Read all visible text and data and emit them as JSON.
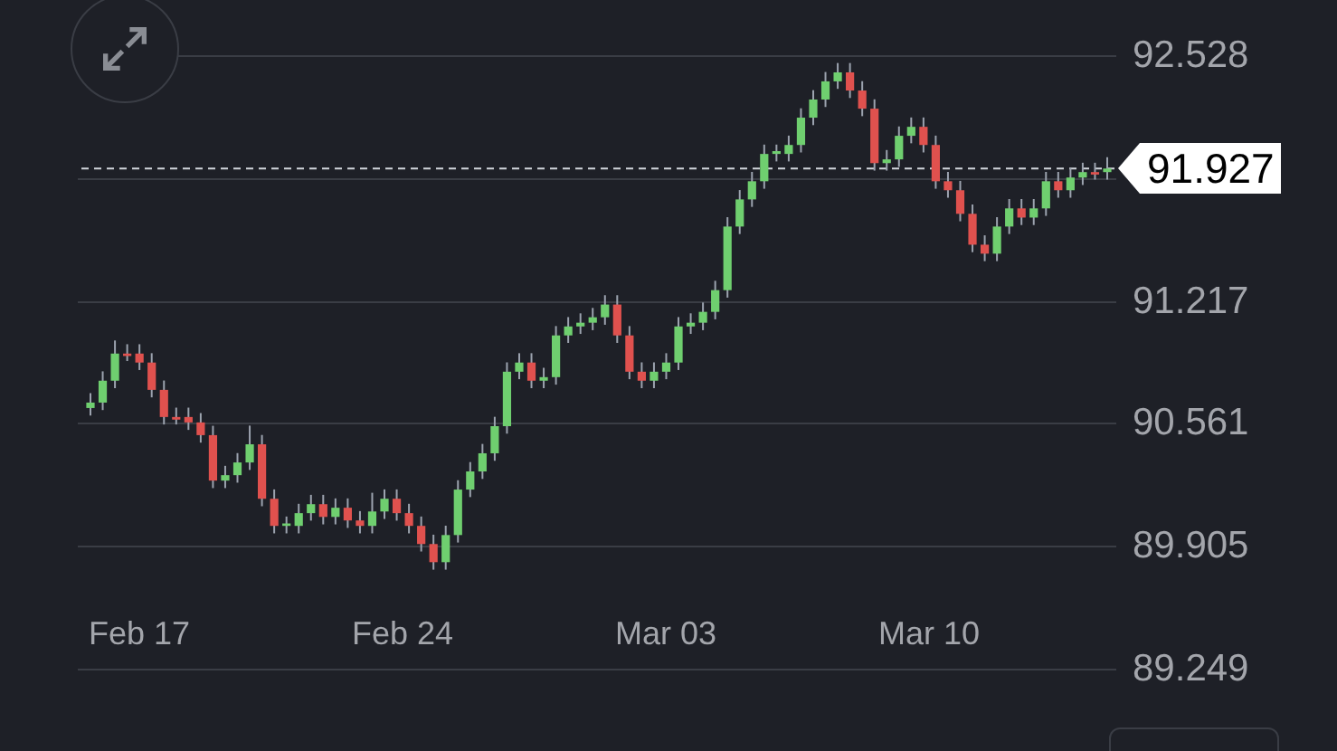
{
  "date_axis": {
    "labels": [
      "Feb 17",
      "Feb 24",
      "Mar 03",
      "Mar 10"
    ]
  },
  "chart_data": {
    "type": "candlestick",
    "ylim": [
      89.249,
      92.528
    ],
    "grid": true,
    "ref_lines": [
      {
        "axis": "y",
        "value": 91.927,
        "label": "91.927"
      }
    ],
    "yticks": [
      {
        "value": 92.528,
        "label": "92.528"
      },
      {
        "value": 91.217,
        "label": "91.217"
      },
      {
        "value": 90.561,
        "label": "90.561"
      },
      {
        "value": 89.905,
        "label": "89.905"
      },
      {
        "value": 89.249,
        "label": "89.249"
      }
    ],
    "ohlc": [
      [
        90.647,
        90.726,
        90.607,
        90.676
      ],
      [
        90.676,
        90.843,
        90.636,
        90.793
      ],
      [
        90.793,
        91.008,
        90.753,
        90.938
      ],
      [
        90.938,
        90.988,
        90.898,
        90.925
      ],
      [
        90.938,
        90.988,
        90.85,
        90.89
      ],
      [
        90.89,
        90.94,
        90.704,
        90.744
      ],
      [
        90.744,
        90.794,
        90.559,
        90.599
      ],
      [
        90.599,
        90.649,
        90.559,
        90.585
      ],
      [
        90.599,
        90.649,
        90.53,
        90.57
      ],
      [
        90.57,
        90.62,
        90.462,
        90.502
      ],
      [
        90.502,
        90.552,
        90.219,
        90.259
      ],
      [
        90.259,
        90.338,
        90.219,
        90.288
      ],
      [
        90.288,
        90.406,
        90.248,
        90.356
      ],
      [
        90.356,
        90.553,
        90.316,
        90.453
      ],
      [
        90.453,
        90.503,
        90.122,
        90.162
      ],
      [
        90.162,
        90.212,
        89.977,
        90.017
      ],
      [
        90.017,
        90.067,
        89.977,
        90.03
      ],
      [
        90.017,
        90.135,
        89.977,
        90.085
      ],
      [
        90.085,
        90.183,
        90.045,
        90.133
      ],
      [
        90.133,
        90.183,
        90.025,
        90.065
      ],
      [
        90.065,
        90.164,
        90.025,
        90.114
      ],
      [
        90.114,
        90.164,
        90.006,
        90.046
      ],
      [
        90.046,
        90.096,
        89.977,
        90.017
      ],
      [
        90.017,
        90.194,
        89.977,
        90.094
      ],
      [
        90.094,
        90.212,
        90.054,
        90.162
      ],
      [
        90.162,
        90.212,
        90.045,
        90.085
      ],
      [
        90.085,
        90.135,
        89.977,
        90.017
      ],
      [
        90.017,
        90.067,
        89.88,
        89.92
      ],
      [
        89.92,
        89.97,
        89.783,
        89.823
      ],
      [
        89.823,
        90.018,
        89.783,
        89.968
      ],
      [
        89.968,
        90.261,
        89.928,
        90.211
      ],
      [
        90.211,
        90.358,
        90.171,
        90.308
      ],
      [
        90.308,
        90.455,
        90.268,
        90.405
      ],
      [
        90.405,
        90.6,
        90.365,
        90.55
      ],
      [
        90.55,
        90.891,
        90.51,
        90.841
      ],
      [
        90.841,
        90.94,
        90.801,
        90.89
      ],
      [
        90.89,
        90.94,
        90.753,
        90.793
      ],
      [
        90.793,
        90.862,
        90.753,
        90.812
      ],
      [
        90.812,
        91.085,
        90.772,
        91.035
      ],
      [
        91.035,
        91.133,
        90.995,
        91.083
      ],
      [
        91.083,
        91.153,
        91.043,
        91.103
      ],
      [
        91.103,
        91.182,
        91.063,
        91.132
      ],
      [
        91.132,
        91.25,
        91.092,
        91.2
      ],
      [
        91.2,
        91.25,
        90.995,
        91.035
      ],
      [
        91.035,
        91.085,
        90.801,
        90.841
      ],
      [
        90.841,
        90.891,
        90.753,
        90.793
      ],
      [
        90.793,
        90.891,
        90.753,
        90.841
      ],
      [
        90.841,
        90.94,
        90.801,
        90.89
      ],
      [
        90.89,
        91.133,
        90.85,
        91.083
      ],
      [
        91.083,
        91.153,
        91.043,
        91.103
      ],
      [
        91.103,
        91.211,
        91.063,
        91.161
      ],
      [
        91.161,
        91.327,
        91.121,
        91.277
      ],
      [
        91.277,
        91.667,
        91.237,
        91.617
      ],
      [
        91.617,
        91.812,
        91.577,
        91.762
      ],
      [
        91.762,
        91.909,
        91.722,
        91.859
      ],
      [
        91.859,
        92.055,
        91.819,
        92.005
      ],
      [
        92.005,
        92.055,
        91.965,
        92.02
      ],
      [
        92.005,
        92.103,
        91.965,
        92.053
      ],
      [
        92.053,
        92.249,
        92.013,
        92.199
      ],
      [
        92.199,
        92.346,
        92.159,
        92.296
      ],
      [
        92.296,
        92.443,
        92.256,
        92.393
      ],
      [
        92.393,
        92.491,
        92.353,
        92.441
      ],
      [
        92.441,
        92.491,
        92.304,
        92.344
      ],
      [
        92.344,
        92.394,
        92.207,
        92.247
      ],
      [
        92.247,
        92.297,
        91.916,
        91.956
      ],
      [
        91.956,
        92.026,
        91.916,
        91.976
      ],
      [
        91.976,
        92.152,
        91.936,
        92.102
      ],
      [
        92.102,
        92.2,
        92.062,
        92.15
      ],
      [
        92.15,
        92.2,
        92.013,
        92.053
      ],
      [
        92.053,
        92.103,
        91.819,
        91.859
      ],
      [
        91.859,
        91.909,
        91.771,
        91.811
      ],
      [
        91.811,
        91.861,
        91.645,
        91.685
      ],
      [
        91.685,
        91.735,
        91.48,
        91.52
      ],
      [
        91.52,
        91.57,
        91.432,
        91.472
      ],
      [
        91.472,
        91.667,
        91.432,
        91.617
      ],
      [
        91.617,
        91.764,
        91.577,
        91.714
      ],
      [
        91.714,
        91.764,
        91.625,
        91.665
      ],
      [
        91.665,
        91.764,
        91.625,
        91.714
      ],
      [
        91.714,
        91.909,
        91.674,
        91.859
      ],
      [
        91.859,
        91.909,
        91.771,
        91.811
      ],
      [
        91.811,
        91.929,
        91.771,
        91.879
      ],
      [
        91.879,
        91.958,
        91.839,
        91.908
      ],
      [
        91.908,
        91.958,
        91.868,
        91.895
      ],
      [
        91.908,
        91.987,
        91.868,
        91.927
      ]
    ]
  }
}
